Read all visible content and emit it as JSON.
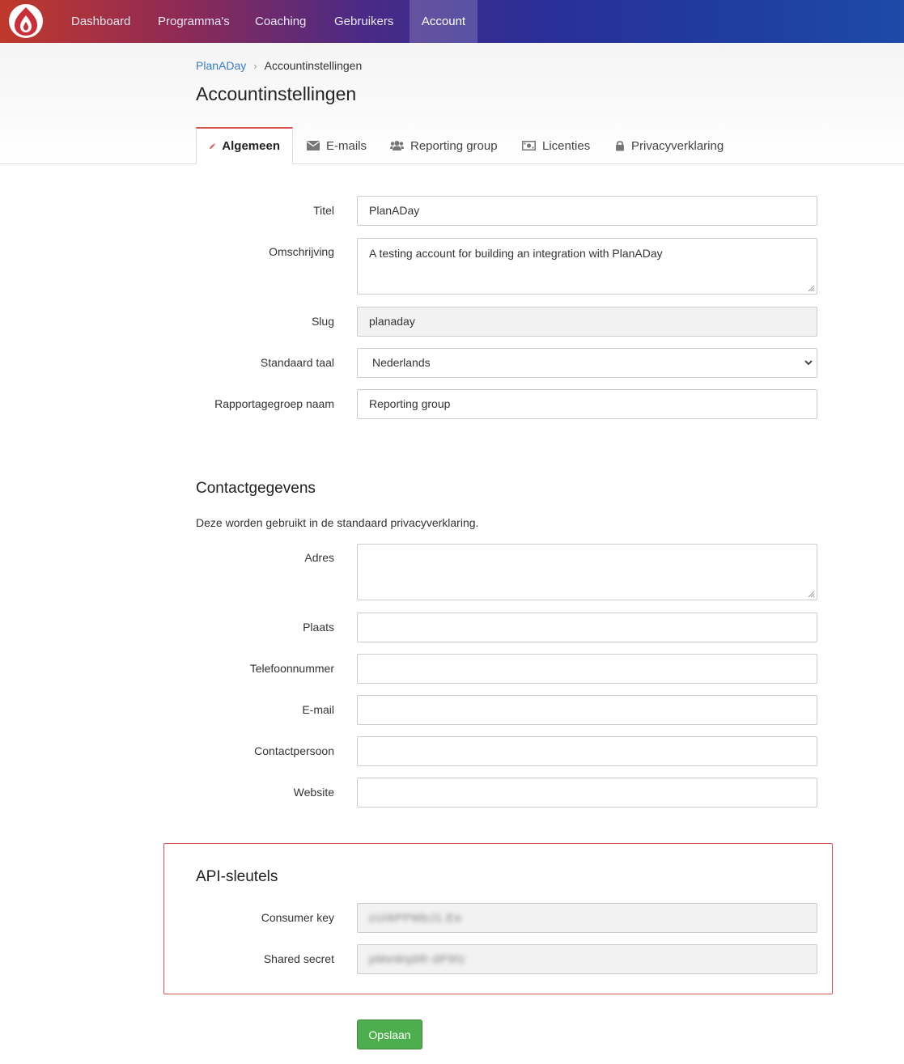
{
  "nav": {
    "items": [
      {
        "label": "Dashboard",
        "active": false
      },
      {
        "label": "Programma's",
        "active": false
      },
      {
        "label": "Coaching",
        "active": false
      },
      {
        "label": "Gebruikers",
        "active": false
      },
      {
        "label": "Account",
        "active": true
      }
    ]
  },
  "breadcrumb": {
    "home": "PlanADay",
    "current": "Accountinstellingen"
  },
  "page": {
    "title": "Accountinstellingen"
  },
  "tabs": [
    {
      "label": "Algemeen",
      "icon": "pencil-icon",
      "active": true
    },
    {
      "label": "E-mails",
      "icon": "envelope-icon",
      "active": false
    },
    {
      "label": "Reporting group",
      "icon": "users-icon",
      "active": false
    },
    {
      "label": "Licenties",
      "icon": "money-icon",
      "active": false
    },
    {
      "label": "Privacyverklaring",
      "icon": "lock-icon",
      "active": false
    }
  ],
  "general": {
    "titel": {
      "label": "Titel",
      "value": "PlanADay"
    },
    "omschrijving": {
      "label": "Omschrijving",
      "value": "A testing account for building an integration with PlanADay"
    },
    "slug": {
      "label": "Slug",
      "value": "planaday"
    },
    "taal": {
      "label": "Standaard taal",
      "value": "Nederlands"
    },
    "rapportage": {
      "label": "Rapportagegroep naam",
      "value": "Reporting group"
    }
  },
  "contact": {
    "title": "Contactgegevens",
    "description": "Deze worden gebruikt in de standaard privacyverklaring.",
    "adres": {
      "label": "Adres",
      "value": ""
    },
    "plaats": {
      "label": "Plaats",
      "value": ""
    },
    "telefoon": {
      "label": "Telefoonnummer",
      "value": ""
    },
    "email": {
      "label": "E-mail",
      "value": ""
    },
    "contactpersoon": {
      "label": "Contactpersoon",
      "value": ""
    },
    "website": {
      "label": "Website",
      "value": ""
    }
  },
  "api": {
    "title": "API-sleutels",
    "consumer_key": {
      "label": "Consumer key",
      "value": "zUi6PPMbJ1.Ee"
    },
    "shared_secret": {
      "label": "Shared secret",
      "value": "pMeWq9R-dP9fz"
    }
  },
  "actions": {
    "save": "Opslaan"
  },
  "colors": {
    "accent_red": "#d9534f",
    "link_blue": "#3a7bc8",
    "save_green": "#4cae4c"
  }
}
